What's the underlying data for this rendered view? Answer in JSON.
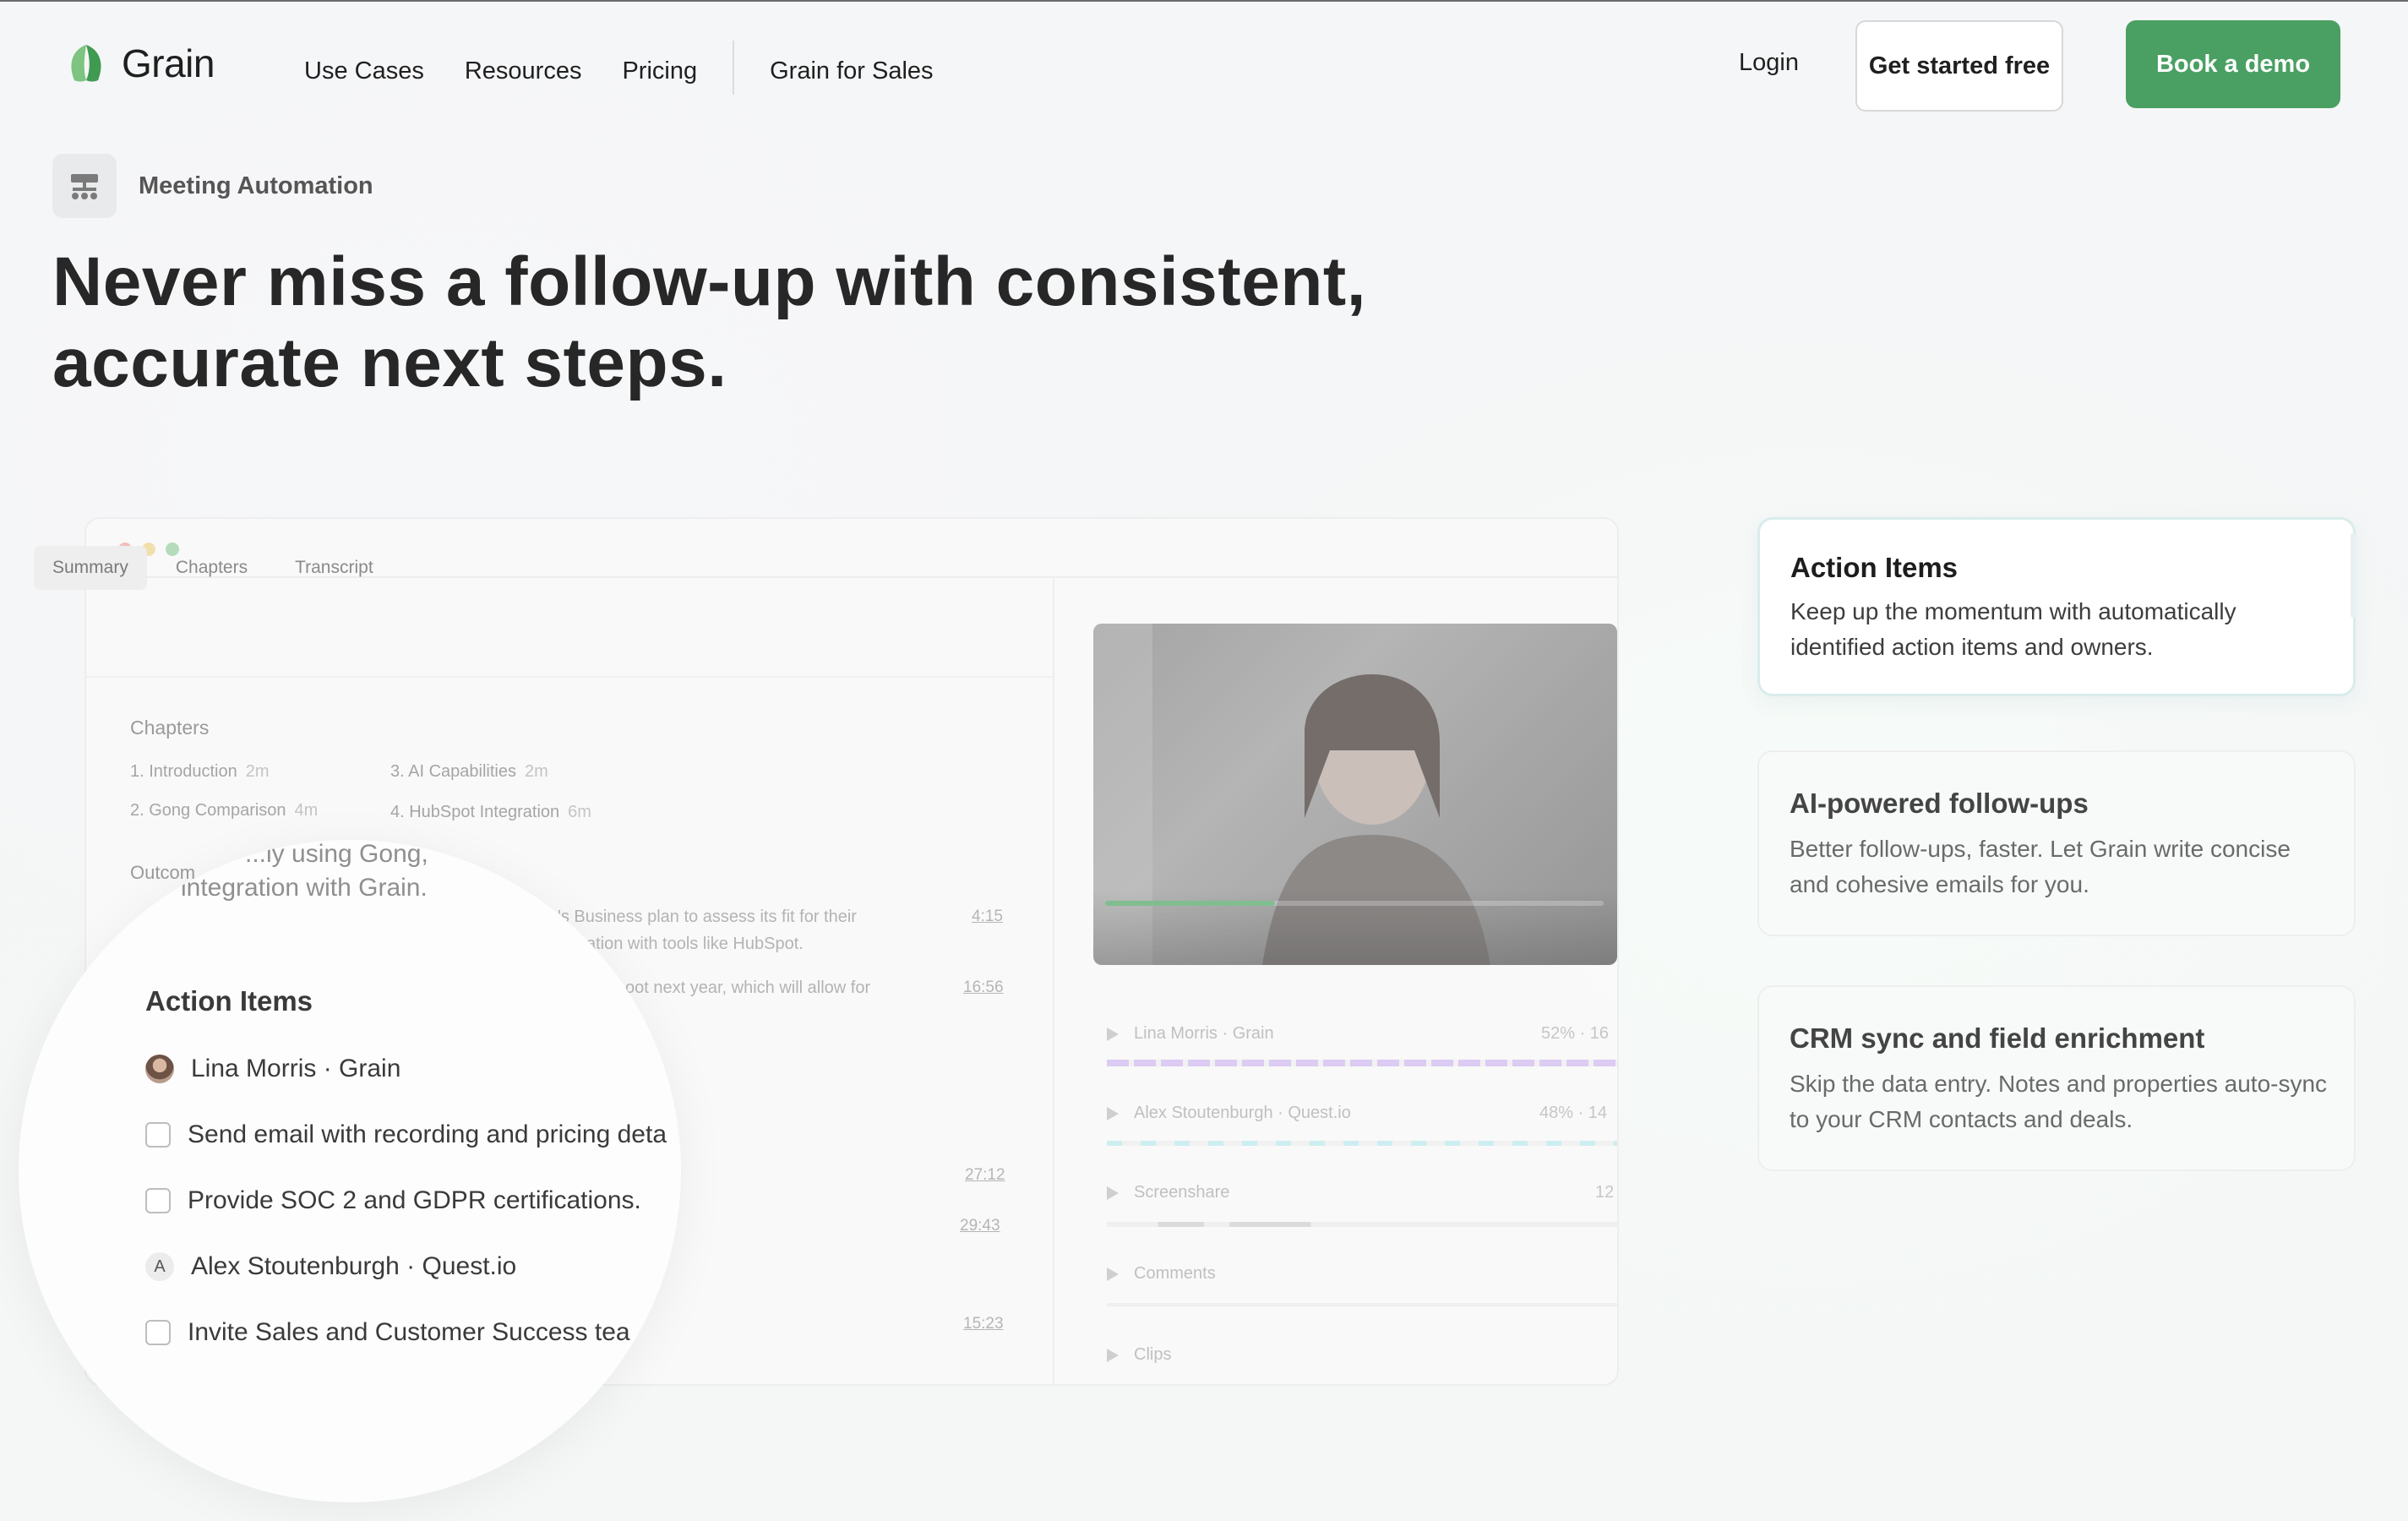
{
  "nav": {
    "brand": "Grain",
    "links": [
      "Use Cases",
      "Resources",
      "Pricing",
      "Grain for Sales"
    ],
    "login": "Login",
    "cta_primary": "Get started free",
    "cta_demo": "Book a demo",
    "brand_color": "#4a9f62"
  },
  "hero": {
    "badge": "Meeting Automation",
    "headline_line1": "Never miss a follow-up with consistent,",
    "headline_line2": "accurate next steps."
  },
  "mock": {
    "tabs": [
      "Summary",
      "Chapters",
      "Transcript"
    ],
    "chapters_title": "Chapters",
    "chapters": [
      {
        "label": "1. Introduction",
        "dur": "2m"
      },
      {
        "label": "3. AI Capabilities",
        "dur": "2m"
      },
      {
        "label": "2. Gong Comparison",
        "dur": "4m"
      },
      {
        "label": "4. HubSpot Integration",
        "dur": "6m"
      }
    ],
    "outcome_label": "Outcom",
    "summary_lines": [
      "'s Business plan to assess its fit for their",
      "ation with tools like HubSpot.",
      "oot next year, which will allow for"
    ],
    "timestamps": [
      "4:15",
      "16:56",
      "27:12",
      "29:43",
      "15:23"
    ],
    "tracks": [
      {
        "label": "Lina Morris · Grain",
        "pct": "52% · 16"
      },
      {
        "label": "Alex Stoutenburgh · Quest.io",
        "pct": "48% · 14"
      },
      {
        "label": "Screenshare",
        "pct": "12"
      },
      {
        "label": "Comments",
        "pct": ""
      },
      {
        "label": "Clips",
        "pct": ""
      }
    ]
  },
  "magnifier": {
    "faint_line1": "...ly using Gong,",
    "faint_line2": "integration with Grain.",
    "title": "Action Items",
    "owner1": "Lina Morris · Grain",
    "item1": "Send email with recording and pricing deta",
    "item2": "Provide SOC 2 and GDPR certifications.",
    "owner2_initial": "A",
    "owner2": "Alex Stoutenburgh · Quest.io",
    "item3": "Invite Sales and Customer Success tea"
  },
  "features": [
    {
      "title": "Action Items",
      "desc": "Keep up the momentum with automatically identified action items and owners."
    },
    {
      "title": "AI-powered follow-ups",
      "desc": "Better follow-ups, faster. Let Grain write concise and cohesive emails for you."
    },
    {
      "title": "CRM sync and field enrichment",
      "desc": "Skip the data entry. Notes and properties auto-sync to your CRM contacts and deals."
    }
  ]
}
